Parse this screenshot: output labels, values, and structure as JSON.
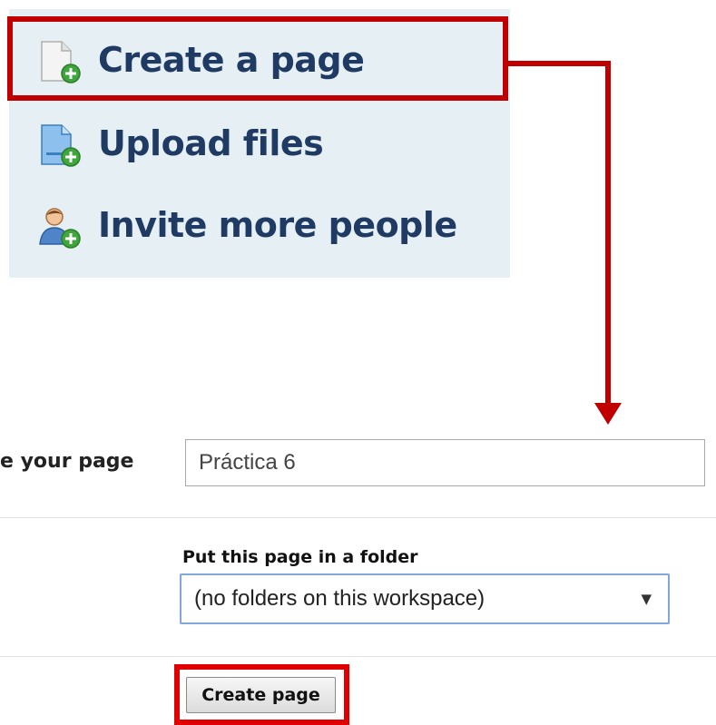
{
  "actions": {
    "create_page": {
      "label": "Create a page",
      "icon": "page-add-icon"
    },
    "upload_files": {
      "label": "Upload files",
      "icon": "file-upload-icon"
    },
    "invite_people": {
      "label": "Invite more people",
      "icon": "user-add-icon"
    }
  },
  "form": {
    "name_label": "e your page",
    "name_value": "Práctica 6",
    "folder_label": "Put this page in a folder",
    "folder_value": "(no folders on this workspace)",
    "submit_label": "Create page"
  },
  "colors": {
    "panel_bg": "#e6eff3",
    "link_text": "#1f3b64",
    "highlight": "#c00000",
    "select_border": "#7fa6dd"
  }
}
